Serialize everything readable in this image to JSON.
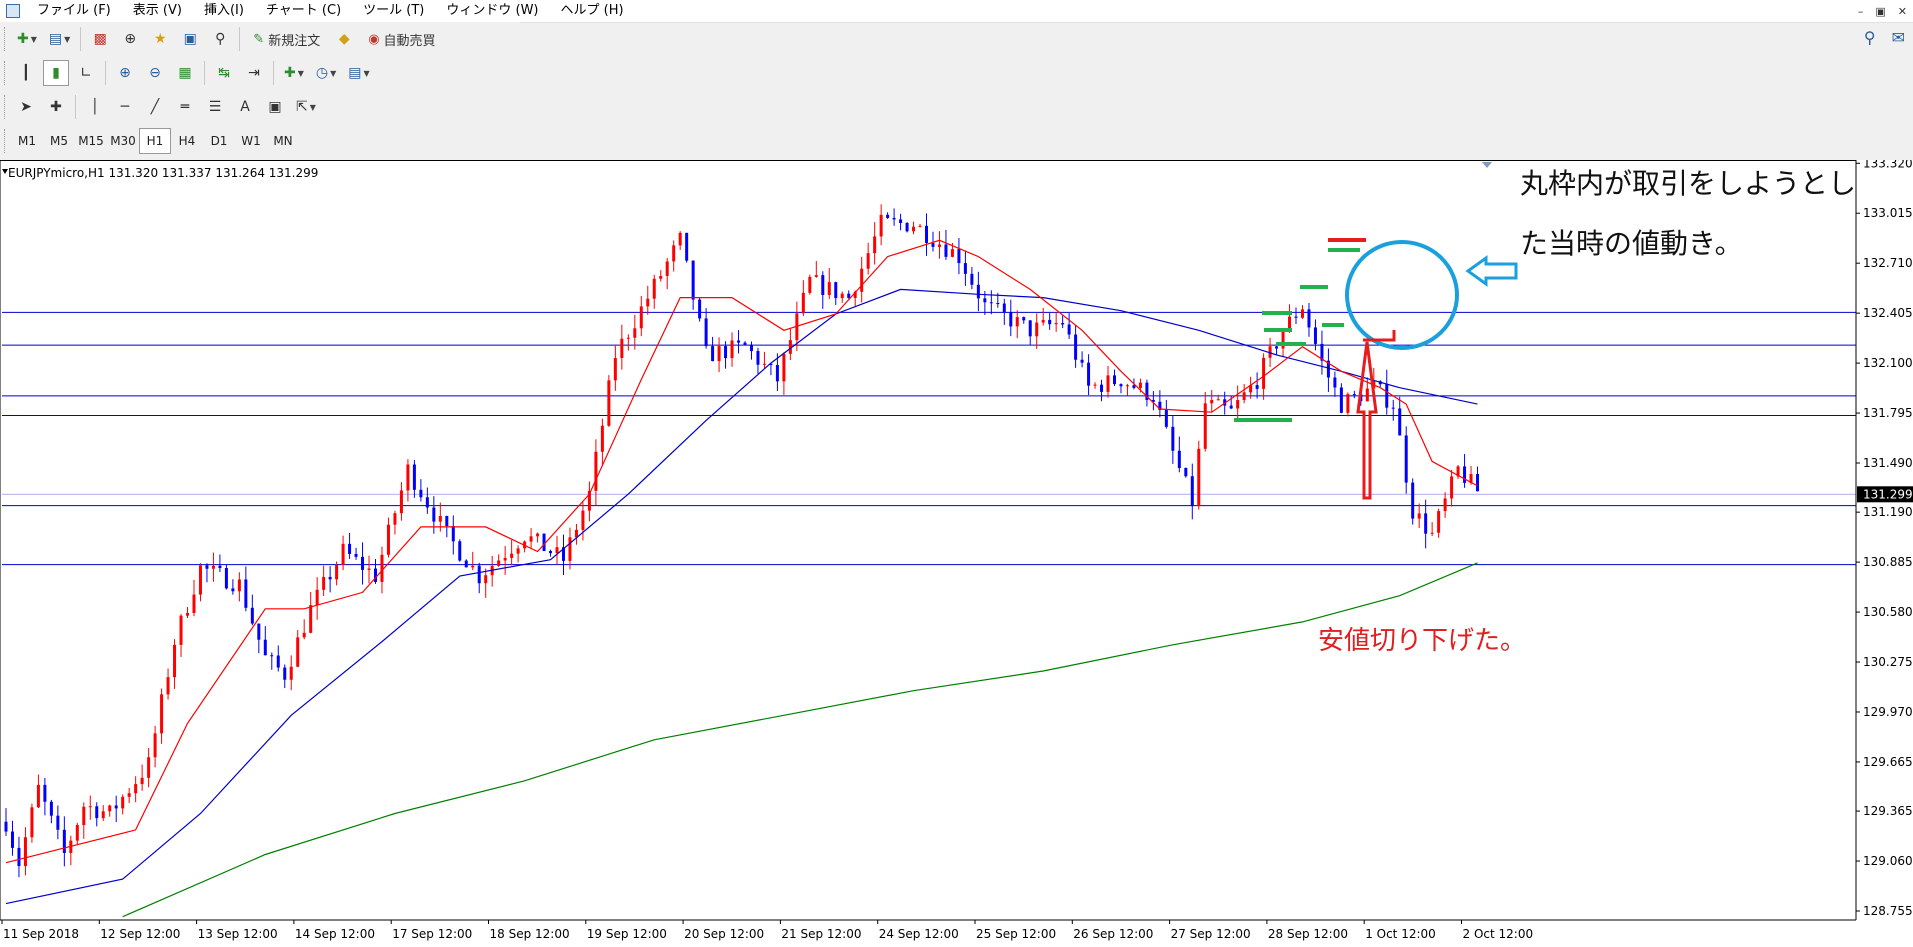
{
  "menu": [
    "ファイル (F)",
    "表示 (V)",
    "挿入(I)",
    "チャート (C)",
    "ツール (T)",
    "ウィンドウ (W)",
    "ヘルプ (H)"
  ],
  "toolbar": {
    "new_order": "新規注文",
    "auto_trade": "自動売買"
  },
  "timeframes": [
    "M1",
    "M5",
    "M15",
    "M30",
    "H1",
    "H4",
    "D1",
    "W1",
    "MN"
  ],
  "active_timeframe": "H1",
  "chart_info": "EURJPYmicro,H1  131.320 131.337 131.264 131.299",
  "annotations": {
    "note_line1": "丸枠内が取引をしようとし",
    "note_line2": "た当時の値動き。",
    "note_low": "安値切り下げた。"
  },
  "colors": {
    "bull": "#ff0000",
    "bear": "#0000ff",
    "ma_short": "#ff0000",
    "ma_mid": "#0000cc",
    "ma_long": "#008000",
    "hline": "#0000cc",
    "circle": "#1aa0dc",
    "green_mark": "#22b14c",
    "red_mark": "#e81c1c"
  },
  "chart_data": {
    "type": "candlestick",
    "title": "EURJPYmicro,H1",
    "ohlc_last": {
      "open": 131.32,
      "high": 131.337,
      "low": 131.264,
      "close": 131.299
    },
    "current_price": "131.299",
    "y_ticks": [
      "133.320",
      "133.015",
      "132.710",
      "132.405",
      "132.100",
      "131.795",
      "131.490",
      "131.190",
      "130.885",
      "130.580",
      "130.275",
      "129.970",
      "129.665",
      "129.365",
      "129.060",
      "128.755"
    ],
    "ylim": [
      128.7,
      133.34
    ],
    "x_ticks": [
      "11 Sep 2018",
      "12 Sep 12:00",
      "13 Sep 12:00",
      "14 Sep 12:00",
      "17 Sep 12:00",
      "18 Sep 12:00",
      "19 Sep 12:00",
      "20 Sep 12:00",
      "21 Sep 12:00",
      "24 Sep 12:00",
      "25 Sep 12:00",
      "26 Sep 12:00",
      "27 Sep 12:00",
      "28 Sep 12:00",
      "1 Oct 12:00",
      "2 Oct 12:00"
    ],
    "horizontal_levels": [
      132.41,
      132.21,
      131.9,
      131.78,
      131.23,
      130.87,
      131.3
    ],
    "path": [
      [
        0,
        129.3
      ],
      [
        2,
        129.05
      ],
      [
        5,
        129.5
      ],
      [
        9,
        129.1
      ],
      [
        12,
        129.4
      ],
      [
        16,
        129.35
      ],
      [
        19,
        129.5
      ],
      [
        22,
        129.65
      ],
      [
        26,
        130.4
      ],
      [
        30,
        130.85
      ],
      [
        36,
        130.75
      ],
      [
        40,
        130.3
      ],
      [
        43,
        130.2
      ],
      [
        47,
        130.6
      ],
      [
        52,
        130.95
      ],
      [
        57,
        130.8
      ],
      [
        62,
        131.45
      ],
      [
        68,
        131.05
      ],
      [
        73,
        130.8
      ],
      [
        80,
        131.05
      ],
      [
        86,
        130.9
      ],
      [
        90,
        131.3
      ],
      [
        94,
        132.15
      ],
      [
        99,
        132.5
      ],
      [
        104,
        132.85
      ],
      [
        108,
        132.15
      ],
      [
        114,
        132.2
      ],
      [
        119,
        132.0
      ],
      [
        124,
        132.6
      ],
      [
        130,
        132.5
      ],
      [
        135,
        132.95
      ],
      [
        140,
        132.95
      ],
      [
        147,
        132.75
      ],
      [
        151,
        132.45
      ],
      [
        158,
        132.3
      ],
      [
        163,
        132.35
      ],
      [
        167,
        131.95
      ],
      [
        172,
        132.0
      ],
      [
        177,
        131.9
      ],
      [
        180,
        131.55
      ],
      [
        183,
        131.25
      ],
      [
        185,
        131.85
      ],
      [
        189,
        131.8
      ],
      [
        193,
        132.0
      ],
      [
        197,
        132.3
      ],
      [
        200,
        132.45
      ],
      [
        203,
        132.1
      ],
      [
        206,
        131.85
      ],
      [
        211,
        131.95
      ],
      [
        214,
        131.85
      ],
      [
        217,
        131.2
      ],
      [
        220,
        131.05
      ],
      [
        224,
        131.45
      ],
      [
        227,
        131.32
      ]
    ],
    "ma_short": [
      [
        0,
        129.05
      ],
      [
        20,
        129.25
      ],
      [
        28,
        129.9
      ],
      [
        40,
        130.6
      ],
      [
        46,
        130.6
      ],
      [
        55,
        130.7
      ],
      [
        64,
        131.1
      ],
      [
        74,
        131.1
      ],
      [
        82,
        130.95
      ],
      [
        90,
        131.3
      ],
      [
        98,
        132.0
      ],
      [
        104,
        132.5
      ],
      [
        112,
        132.5
      ],
      [
        120,
        132.3
      ],
      [
        128,
        132.4
      ],
      [
        136,
        132.75
      ],
      [
        144,
        132.85
      ],
      [
        150,
        132.75
      ],
      [
        158,
        132.55
      ],
      [
        166,
        132.3
      ],
      [
        172,
        132.05
      ],
      [
        178,
        131.82
      ],
      [
        186,
        131.8
      ],
      [
        194,
        132.02
      ],
      [
        200,
        132.2
      ],
      [
        206,
        132.05
      ],
      [
        212,
        131.95
      ],
      [
        216,
        131.85
      ],
      [
        220,
        131.5
      ],
      [
        227,
        131.35
      ]
    ],
    "ma_mid": [
      [
        0,
        128.8
      ],
      [
        18,
        128.95
      ],
      [
        30,
        129.35
      ],
      [
        44,
        129.95
      ],
      [
        58,
        130.4
      ],
      [
        70,
        130.8
      ],
      [
        84,
        130.9
      ],
      [
        96,
        131.3
      ],
      [
        108,
        131.75
      ],
      [
        118,
        132.1
      ],
      [
        128,
        132.4
      ],
      [
        138,
        132.55
      ],
      [
        150,
        132.52
      ],
      [
        160,
        132.5
      ],
      [
        172,
        132.42
      ],
      [
        184,
        132.3
      ],
      [
        196,
        132.15
      ],
      [
        206,
        132.05
      ],
      [
        215,
        131.95
      ],
      [
        227,
        131.85
      ]
    ],
    "ma_long": [
      [
        18,
        128.72
      ],
      [
        40,
        129.1
      ],
      [
        60,
        129.35
      ],
      [
        80,
        129.55
      ],
      [
        100,
        129.8
      ],
      [
        120,
        129.95
      ],
      [
        140,
        130.1
      ],
      [
        160,
        130.22
      ],
      [
        180,
        130.38
      ],
      [
        200,
        130.52
      ],
      [
        215,
        130.68
      ],
      [
        227,
        130.88
      ]
    ]
  }
}
